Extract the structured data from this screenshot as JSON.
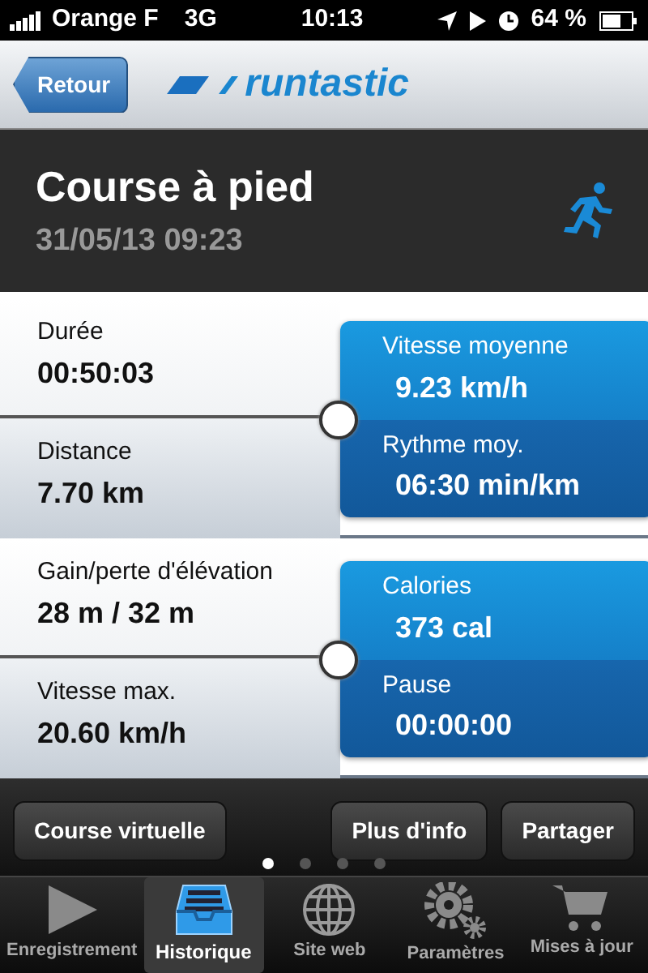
{
  "status_bar": {
    "carrier": "Orange F",
    "network": "3G",
    "time": "10:13",
    "battery": "64 %"
  },
  "nav": {
    "back_button": "Retour",
    "logo": "runtastic"
  },
  "activity": {
    "title": "Course à pied",
    "datetime": "31/05/13 09:23"
  },
  "stat_groups": [
    {
      "left": [
        {
          "label": "Durée",
          "value": "00:50:03"
        },
        {
          "label": "Distance",
          "value": "7.70 km"
        }
      ],
      "right": [
        {
          "label": "Vitesse moyenne",
          "value": "9.23 km/h"
        },
        {
          "label": "Rythme moy.",
          "value": "06:30 min/km"
        }
      ]
    },
    {
      "left": [
        {
          "label": "Gain/perte d'élévation",
          "value": "28 m / 32 m"
        },
        {
          "label": "Vitesse max.",
          "value": "20.60 km/h"
        }
      ],
      "right": [
        {
          "label": "Calories",
          "value": "373 cal"
        },
        {
          "label": "Pause",
          "value": "00:00:00"
        }
      ]
    }
  ],
  "actions": [
    {
      "label": "Course virtuelle"
    },
    {
      "label": "Plus d'info"
    },
    {
      "label": "Partager"
    }
  ],
  "page_dots": [
    {
      "selected": true
    },
    {
      "selected": false
    },
    {
      "selected": false
    },
    {
      "selected": false
    }
  ],
  "tabs": [
    {
      "label": "Enregistrement",
      "kind": "play",
      "selected": false
    },
    {
      "label": "Historique",
      "kind": "tray",
      "selected": true
    },
    {
      "label": "Site web",
      "kind": "globe",
      "selected": false
    },
    {
      "label": "Paramètres",
      "kind": "gears",
      "selected": false
    },
    {
      "label": "Mises à jour",
      "kind": "cart",
      "selected": false
    }
  ]
}
